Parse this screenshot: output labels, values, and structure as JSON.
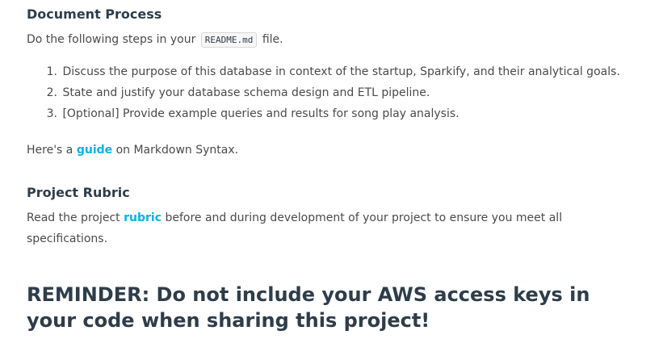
{
  "document_process": {
    "heading": "Document Process",
    "intro_before": "Do the following steps in your ",
    "intro_code": "README.md",
    "intro_after": " file.",
    "steps": [
      {
        "number": "1.",
        "text": "Discuss the purpose of this database in context of the startup, Sparkify, and their analytical goals."
      },
      {
        "number": "2.",
        "text": "State and justify your database schema design and ETL pipeline."
      },
      {
        "number": "3.",
        "text": "[Optional] Provide example queries and results for song play analysis."
      }
    ],
    "guide_before": "Here's a ",
    "guide_link": "guide",
    "guide_after": " on Markdown Syntax."
  },
  "project_rubric": {
    "heading": "Project Rubric",
    "text_before": "Read the project ",
    "rubric_link": "rubric",
    "text_after": " before and during development of your project to ensure you meet all specifications."
  },
  "reminder": {
    "text": "REMINDER: Do not include your AWS access keys in your code when sharing this project!"
  }
}
